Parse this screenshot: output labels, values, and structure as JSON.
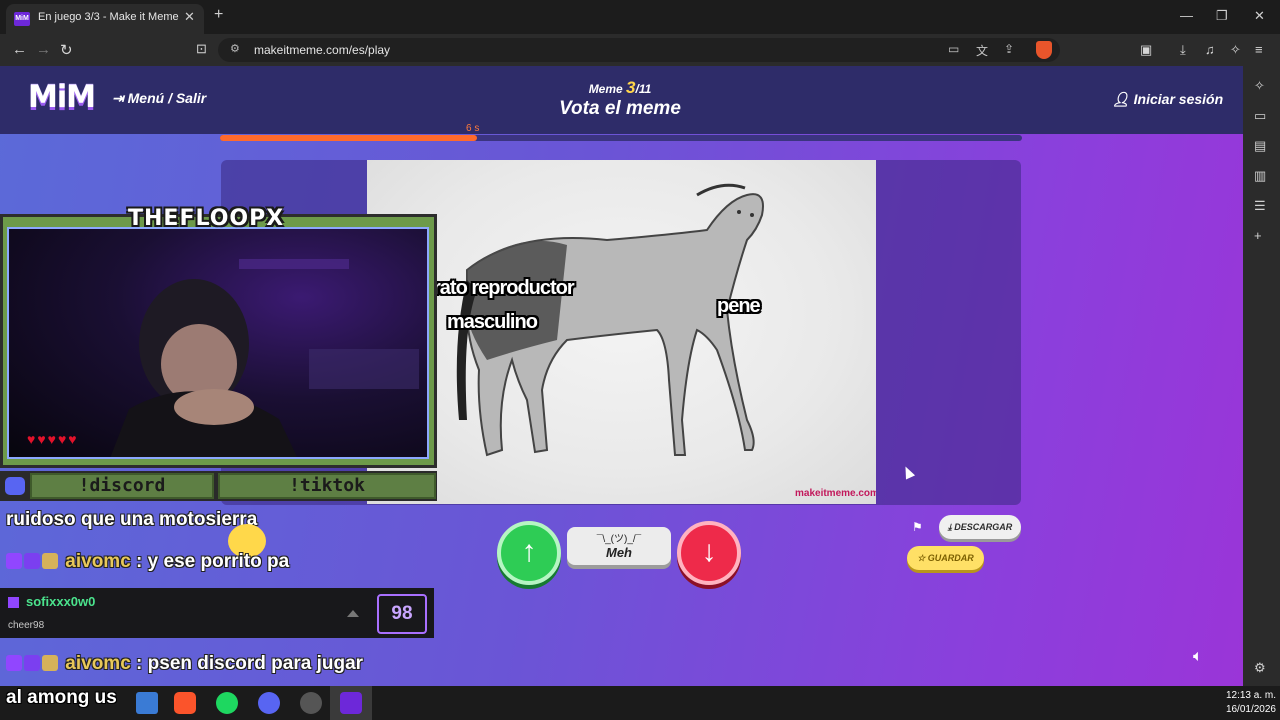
{
  "browser": {
    "tab_title": "En juego 3/3 - Make it Meme",
    "tab_favicon": "MiM",
    "url": "makeitmeme.com/es/play"
  },
  "header": {
    "logo": "MiM",
    "menu_exit": "Menú / Salir",
    "meme_label": "Meme",
    "meme_index": "3",
    "meme_total": "/11",
    "title": "Vota el meme",
    "login": "Iniciar sesión",
    "timer": "6 s",
    "progress_fraction": 0.32
  },
  "meme": {
    "caption_left_1": "rato reproductor",
    "caption_left_2": "masculino",
    "caption_right": "pene",
    "watermark": "makeitmeme.com"
  },
  "vote": {
    "up_icon": "arrow-up-icon",
    "meh_face": "¯\\_(ツ)_/¯",
    "meh_label": "Meh",
    "down_icon": "arrow-down-icon"
  },
  "actions": {
    "download": "DESCARGAR",
    "save": "GUARDAR"
  },
  "stream": {
    "cam_name": "THEFLOOPX",
    "cmd_discord": "!discord",
    "cmd_tiktok": "!tiktok",
    "chat": [
      {
        "user": "",
        "message": "ruidoso que una motosierra"
      },
      {
        "user": "aivomc",
        "message": " : y ese porrito pa"
      },
      {
        "user": "aivomc",
        "message": " : psen discord para jugar"
      }
    ],
    "cheer_user": "sofixxx0w0",
    "cheer_text": "cheer98",
    "cheer_amount": "98",
    "taskbar_text": "al among us"
  },
  "taskbar": {
    "time": "12:13 a. m.",
    "date": "16/01/2026"
  },
  "colors": {
    "accent_orange": "#ff6a2c",
    "vote_up": "#2ecc55",
    "vote_down": "#ee2a4a",
    "save_yellow": "#ffe066"
  }
}
